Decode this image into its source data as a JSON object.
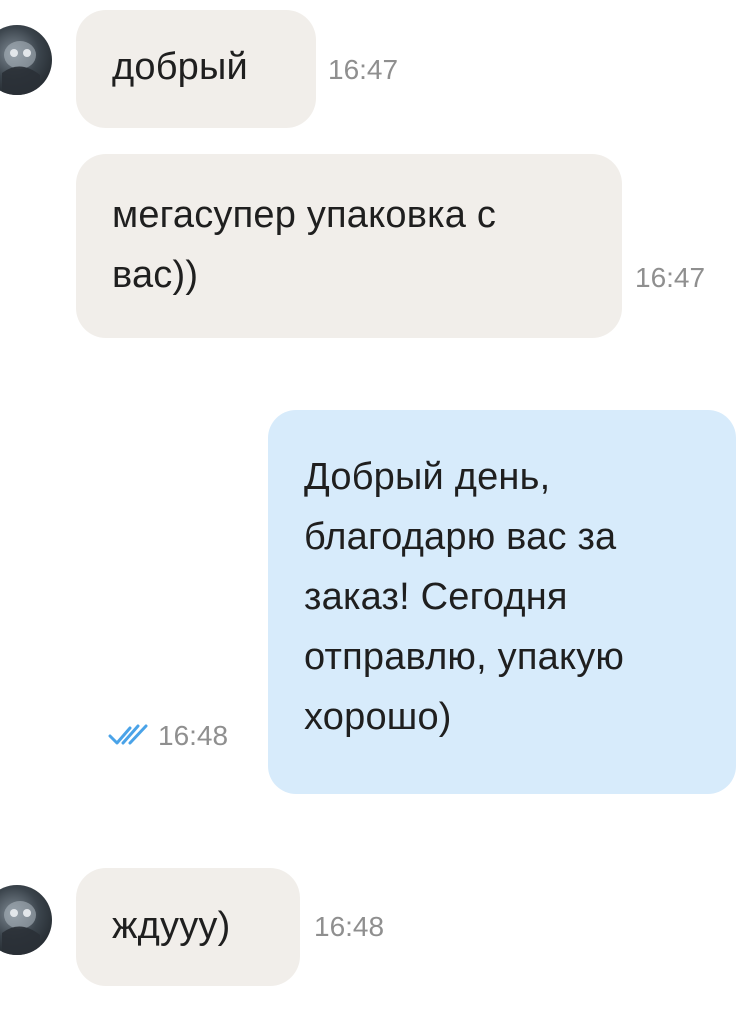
{
  "messages": [
    {
      "direction": "in",
      "text": "добрый",
      "time": "16:47",
      "avatar": "contact-avatar"
    },
    {
      "direction": "in",
      "text": "мегасупер упаковка с\nвас))",
      "time": "16:47"
    },
    {
      "direction": "out",
      "text": "Добрый день,\nблагодарю вас за\nзаказ! Сегодня\nотправлю, упакую\nхорошо)",
      "time": "16:48",
      "status_icon": "double-check-icon",
      "status_color": "#4aa3e8"
    },
    {
      "direction": "in",
      "text": "ждууу)",
      "time": "16:48",
      "avatar": "contact-avatar"
    }
  ],
  "colors": {
    "incoming_bubble": "#f1eeea",
    "outgoing_bubble": "#d7ebfb",
    "timestamp": "#8f8f8f",
    "read_check": "#4aa3e8"
  }
}
